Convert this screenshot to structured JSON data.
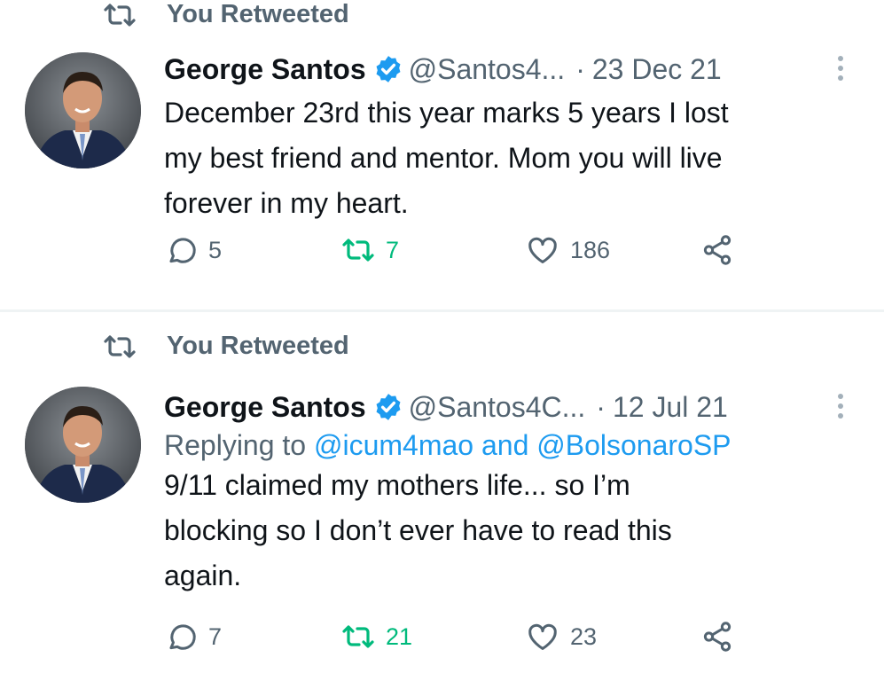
{
  "tweets": [
    {
      "retweet_label": "You Retweeted",
      "name": "George Santos",
      "handle": "@Santos4...",
      "separator": "·",
      "date": "23 Dec 21",
      "replying_prefix": "",
      "replying_mentions": [],
      "text_lines": [
        "December 23rd this year marks 5 years I lost",
        "my best friend and mentor. Mom you will live",
        "forever in my heart."
      ],
      "stats": {
        "replies": "5",
        "retweets": "7",
        "likes": "186"
      }
    },
    {
      "retweet_label": "You Retweeted",
      "name": "George Santos",
      "handle": "@Santos4C...",
      "separator": "·",
      "date": "12 Jul 21",
      "replying_prefix": "Replying to",
      "replying_mentions": [
        "@icum4mao",
        "and",
        "@BolsonaroSP"
      ],
      "text_lines": [
        "9/11 claimed my mothers life... so I’m",
        "blocking so I don’t ever have to read this",
        "again."
      ],
      "stats": {
        "replies": "7",
        "retweets": "21",
        "likes": "23"
      }
    }
  ],
  "icons": {
    "retweet": "retweet-icon",
    "verified": "verified-badge-icon",
    "reply": "reply-icon",
    "like": "heart-icon",
    "share": "share-icon",
    "more": "more-options-icon"
  },
  "colors": {
    "text_primary": "#0f1419",
    "text_secondary": "#536471",
    "accent_blue": "#1d9bf0",
    "retweet_green": "#00ba7c",
    "divider": "#eff3f4"
  }
}
